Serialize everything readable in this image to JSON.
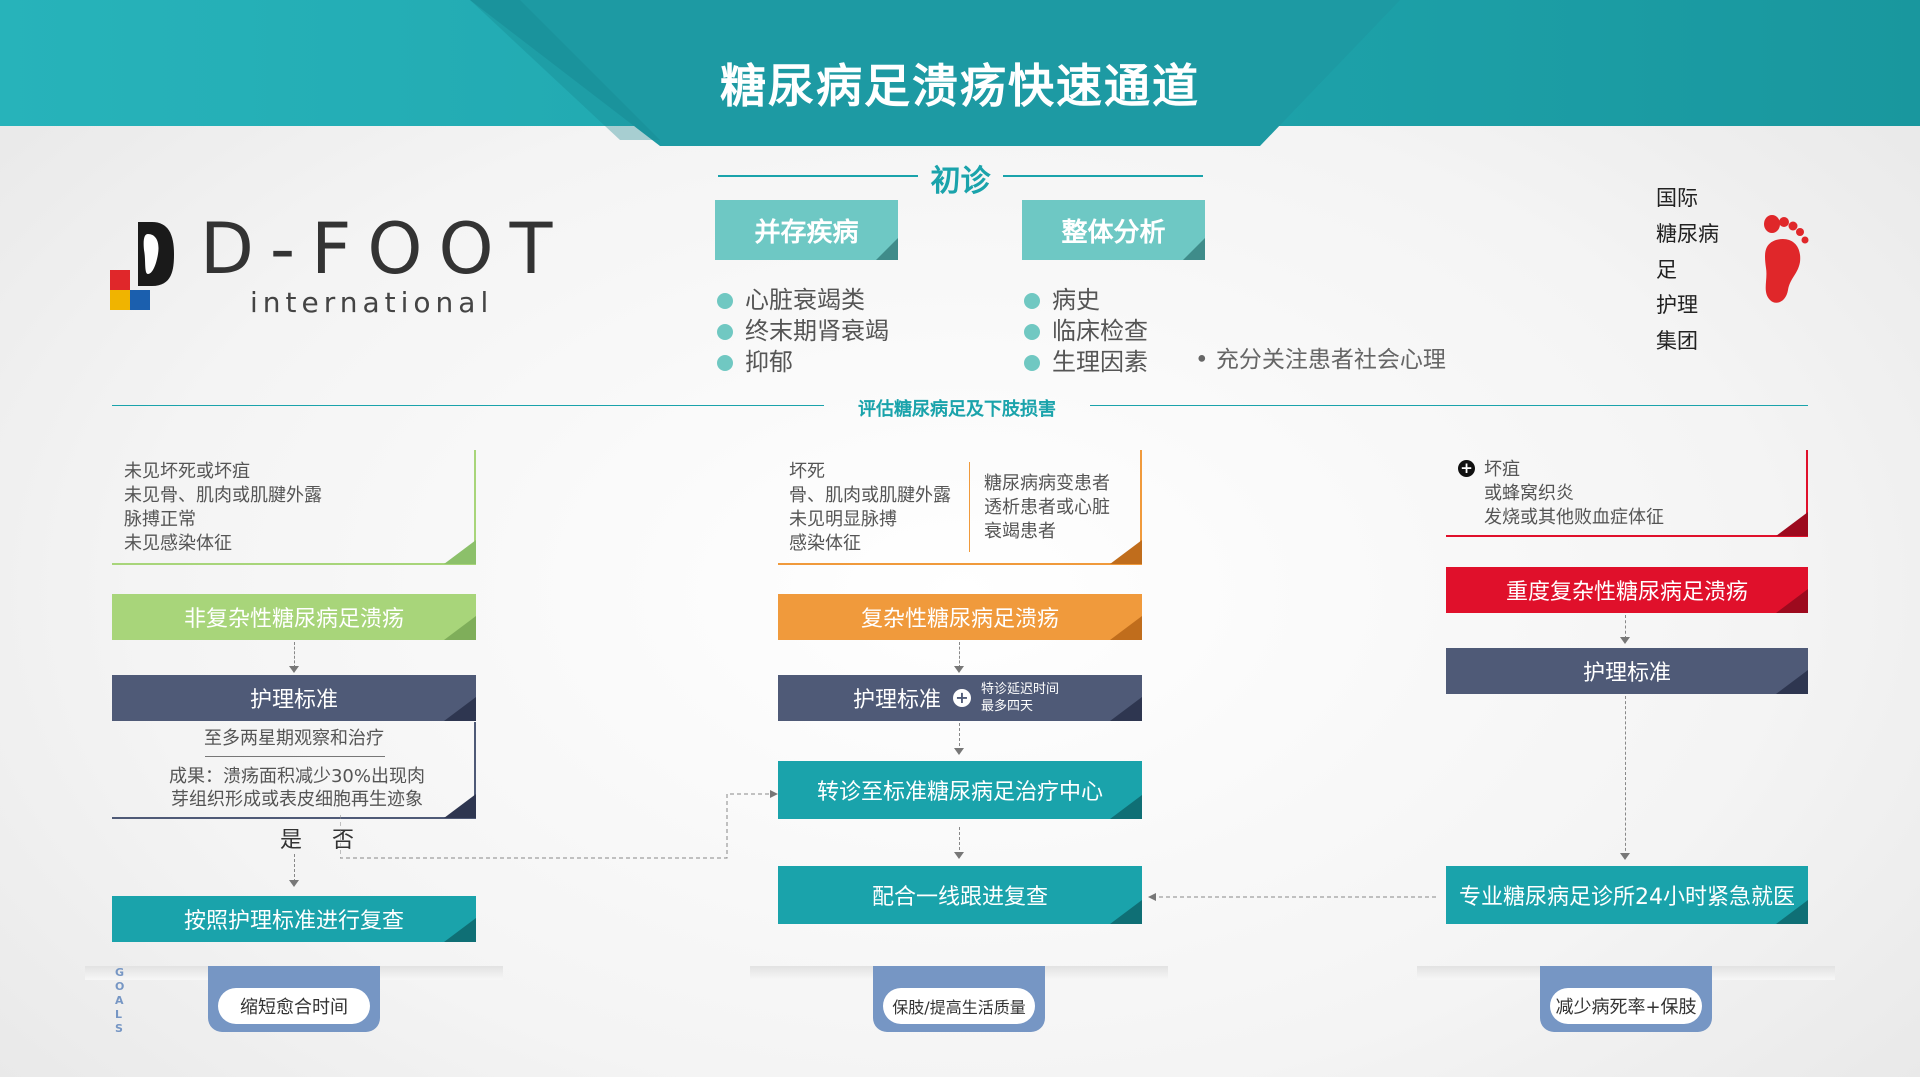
{
  "title": "糖尿病足溃疡快速通道",
  "logo": {
    "word": "D-FOOT",
    "sub": "international"
  },
  "brand": {
    "lines": [
      "国际",
      "糖尿病",
      "足",
      "护理",
      "集团"
    ]
  },
  "initial": {
    "title": "初诊",
    "left": {
      "title": "并存疾病",
      "items": [
        "心脏衰竭类",
        "终末期肾衰竭",
        "抑郁"
      ]
    },
    "right": {
      "title": "整体分析",
      "items": [
        "病史",
        "临床检查",
        "生理因素"
      ]
    },
    "note": "• 充分关注患者社会心理"
  },
  "assess": "评估糖尿病足及下肢损害",
  "col1": {
    "criteria": [
      "未见坏死或坏疽",
      "未见骨、肌肉或肌腱外露",
      "脉搏正常",
      "未见感染体征"
    ],
    "category": "非复杂性糖尿病足溃疡",
    "care": "护理标准",
    "observe": "至多两星期观察和治疗",
    "result": "成果：溃疡面积减少30%出现肉芽组织形成或表皮细胞再生迹象",
    "yes": "是",
    "no": "否",
    "followup": "按照护理标准进行复查",
    "goal": "缩短愈合时间"
  },
  "col2": {
    "criteria_left": [
      "坏死",
      "骨、肌肉或肌腱外露",
      "未见明显脉搏",
      "感染体征"
    ],
    "criteria_right": [
      "糖尿病病变患者",
      "透析患者或心脏",
      "衰竭患者"
    ],
    "category": "复杂性糖尿病足溃疡",
    "care": "护理标准",
    "delay_note_1": "特诊延迟时间",
    "delay_note_2": "最多四天",
    "referral": "转诊至标准糖尿病足治疗中心",
    "followup": "配合一线跟进复查",
    "goal": "保肢/提高生活质量"
  },
  "col3": {
    "criteria": [
      "坏疽",
      "或蜂窝织炎",
      "发烧或其他败血症体征"
    ],
    "category": "重度复杂性糖尿病足溃疡",
    "care": "护理标准",
    "emergency": "专业糖尿病足诊所24小时紧急就医",
    "goal": "减少病死率+保肢"
  },
  "goals_letters": [
    "G",
    "O",
    "A",
    "L",
    "S"
  ],
  "colors": {
    "teal": "#1aa3ab",
    "green": "#a8d57a",
    "orange": "#f09a3c",
    "red": "#e0102b",
    "slate": "#4f5a77",
    "goal_blue": "#7696c4"
  }
}
